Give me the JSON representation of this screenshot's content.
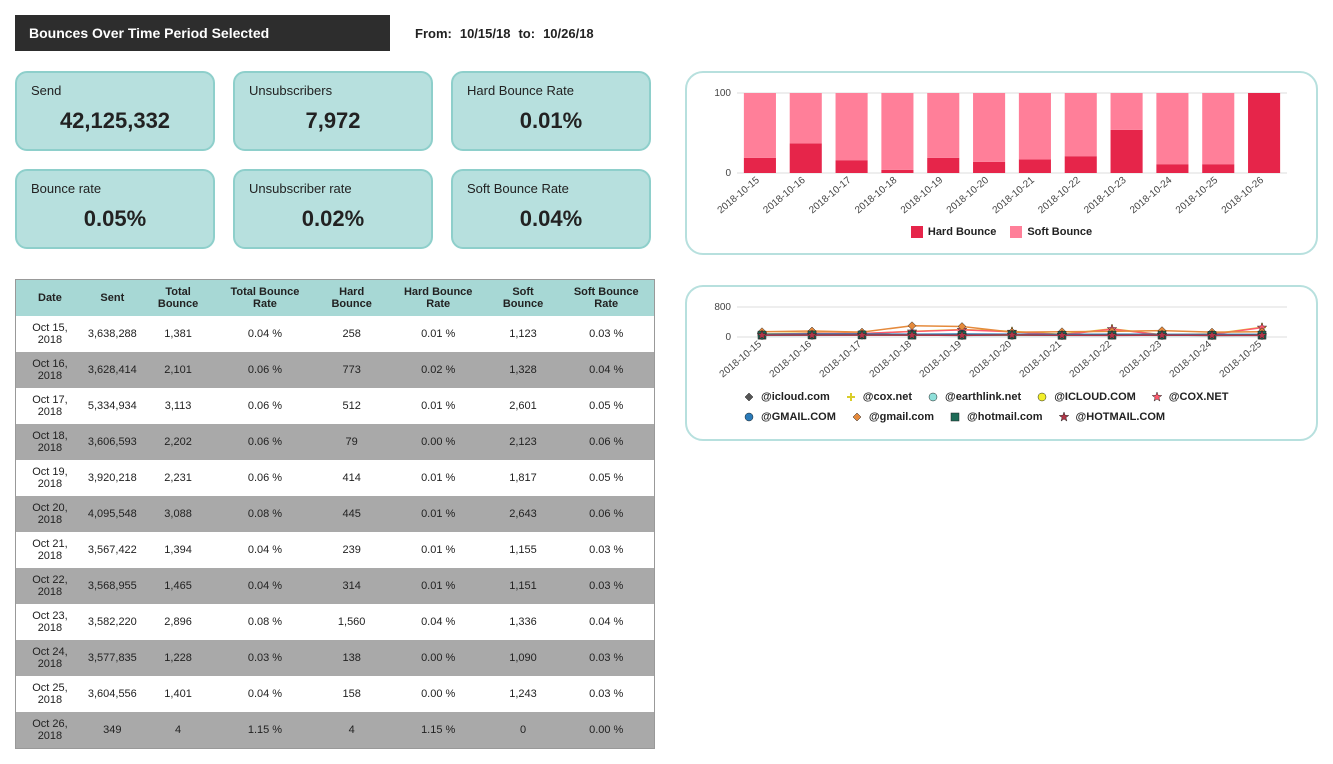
{
  "header": {
    "title": "Bounces Over Time Period Selected",
    "from_label": "From:",
    "from_value": "10/15/18",
    "to_label": "to:",
    "to_value": "10/26/18"
  },
  "metrics": [
    {
      "label": "Send",
      "value": "42,125,332"
    },
    {
      "label": "Unsubscribers",
      "value": "7,972"
    },
    {
      "label": "Hard Bounce Rate",
      "value": "0.01%"
    },
    {
      "label": "Bounce rate",
      "value": "0.05%"
    },
    {
      "label": "Unsubscriber rate",
      "value": "0.02%"
    },
    {
      "label": "Soft Bounce Rate",
      "value": "0.04%"
    }
  ],
  "table": {
    "headers": [
      "Date",
      "Sent",
      "Total Bounce",
      "Total Bounce Rate",
      "Hard Bounce",
      "Hard Bounce Rate",
      "Soft Bounce",
      "Soft Bounce Rate"
    ],
    "rows": [
      [
        "Oct 15, 2018",
        "3,638,288",
        "1,381",
        "0.04 %",
        "258",
        "0.01 %",
        "1,123",
        "0.03 %"
      ],
      [
        "Oct 16, 2018",
        "3,628,414",
        "2,101",
        "0.06 %",
        "773",
        "0.02 %",
        "1,328",
        "0.04 %"
      ],
      [
        "Oct 17, 2018",
        "5,334,934",
        "3,113",
        "0.06 %",
        "512",
        "0.01 %",
        "2,601",
        "0.05 %"
      ],
      [
        "Oct 18, 2018",
        "3,606,593",
        "2,202",
        "0.06 %",
        "79",
        "0.00 %",
        "2,123",
        "0.06 %"
      ],
      [
        "Oct 19, 2018",
        "3,920,218",
        "2,231",
        "0.06 %",
        "414",
        "0.01 %",
        "1,817",
        "0.05 %"
      ],
      [
        "Oct 20, 2018",
        "4,095,548",
        "3,088",
        "0.08 %",
        "445",
        "0.01 %",
        "2,643",
        "0.06 %"
      ],
      [
        "Oct 21, 2018",
        "3,567,422",
        "1,394",
        "0.04 %",
        "239",
        "0.01 %",
        "1,155",
        "0.03 %"
      ],
      [
        "Oct 22, 2018",
        "3,568,955",
        "1,465",
        "0.04 %",
        "314",
        "0.01 %",
        "1,151",
        "0.03 %"
      ],
      [
        "Oct 23, 2018",
        "3,582,220",
        "2,896",
        "0.08 %",
        "1,560",
        "0.04 %",
        "1,336",
        "0.04 %"
      ],
      [
        "Oct 24, 2018",
        "3,577,835",
        "1,228",
        "0.03 %",
        "138",
        "0.00 %",
        "1,090",
        "0.03 %"
      ],
      [
        "Oct 25, 2018",
        "3,604,556",
        "1,401",
        "0.04 %",
        "158",
        "0.00 %",
        "1,243",
        "0.03 %"
      ],
      [
        "Oct 26, 2018",
        "349",
        "4",
        "1.15 %",
        "4",
        "1.15 %",
        "0",
        "0.00 %"
      ]
    ]
  },
  "chart_data": [
    {
      "type": "bar",
      "stacked": true,
      "title": "",
      "ylabel": "",
      "ylim": [
        0,
        100
      ],
      "yticks": [
        0,
        100
      ],
      "categories": [
        "2018-10-15",
        "2018-10-16",
        "2018-10-17",
        "2018-10-18",
        "2018-10-19",
        "2018-10-20",
        "2018-10-21",
        "2018-10-22",
        "2018-10-23",
        "2018-10-24",
        "2018-10-25",
        "2018-10-26"
      ],
      "series": [
        {
          "name": "Hard Bounce",
          "color": "#e6254a",
          "values": [
            19,
            37,
            16,
            4,
            19,
            14,
            17,
            21,
            54,
            11,
            11,
            100
          ]
        },
        {
          "name": "Soft Bounce",
          "color": "#ff7f99",
          "values": [
            81,
            63,
            84,
            96,
            81,
            86,
            83,
            79,
            46,
            89,
            89,
            0
          ]
        }
      ],
      "legend_position": "bottom"
    },
    {
      "type": "line",
      "title": "",
      "ylabel": "",
      "ylim": [
        0,
        800
      ],
      "yticks": [
        0,
        800
      ],
      "categories": [
        "2018-10-15",
        "2018-10-16",
        "2018-10-17",
        "2018-10-18",
        "2018-10-19",
        "2018-10-20",
        "2018-10-21",
        "2018-10-22",
        "2018-10-23",
        "2018-10-24",
        "2018-10-25"
      ],
      "series": [
        {
          "name": "@icloud.com",
          "color": "#555555",
          "marker": "diamond",
          "values": [
            60,
            70,
            65,
            60,
            55,
            60,
            55,
            55,
            60,
            55,
            55
          ]
        },
        {
          "name": "@cox.net",
          "color": "#d9cd2a",
          "marker": "plus",
          "values": [
            80,
            110,
            90,
            150,
            200,
            150,
            70,
            220,
            60,
            80,
            260
          ]
        },
        {
          "name": "@earthlink.net",
          "color": "#8fe0da",
          "marker": "circle",
          "values": [
            40,
            45,
            50,
            55,
            40,
            45,
            40,
            45,
            40,
            40,
            40
          ]
        },
        {
          "name": "@ICLOUD.COM",
          "color": "#f2ef2a",
          "marker": "circle",
          "values": [
            55,
            65,
            60,
            55,
            55,
            55,
            55,
            55,
            55,
            55,
            55
          ]
        },
        {
          "name": "@COX.NET",
          "color": "#ff5a6e",
          "marker": "star",
          "values": [
            70,
            100,
            95,
            145,
            190,
            140,
            60,
            210,
            55,
            70,
            250
          ]
        },
        {
          "name": "@GMAIL.COM",
          "color": "#2a7ab8",
          "marker": "circle",
          "values": [
            75,
            80,
            80,
            75,
            80,
            75,
            70,
            75,
            70,
            70,
            70
          ]
        },
        {
          "name": "@gmail.com",
          "color": "#e58a3c",
          "marker": "diamond",
          "values": [
            140,
            160,
            130,
            300,
            280,
            130,
            140,
            150,
            170,
            130,
            140
          ]
        },
        {
          "name": "@hotmail.com",
          "color": "#1e6b57",
          "marker": "square",
          "values": [
            50,
            55,
            55,
            50,
            50,
            55,
            45,
            50,
            50,
            45,
            50
          ]
        },
        {
          "name": "@HOTMAIL.COM",
          "color": "#b23648",
          "marker": "star",
          "values": [
            50,
            50,
            50,
            50,
            45,
            55,
            45,
            45,
            50,
            45,
            45
          ]
        }
      ],
      "legend_position": "bottom"
    }
  ]
}
